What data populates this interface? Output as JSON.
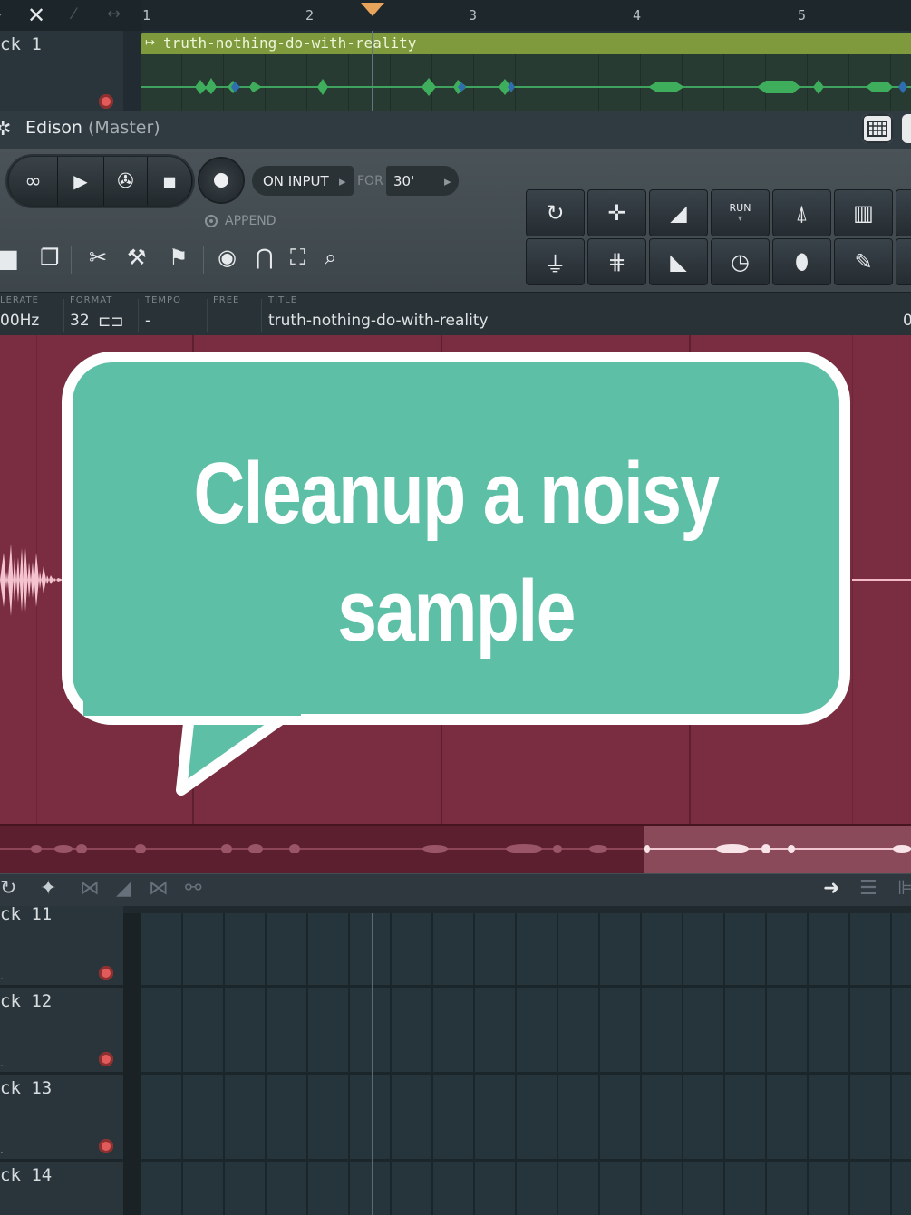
{
  "playlist_top": {
    "ruler": [
      "1",
      "2",
      "3",
      "4",
      "5"
    ],
    "track": {
      "name": "ck 1"
    },
    "clip": {
      "title": "truth-nothing-do-with-reality"
    }
  },
  "edison": {
    "title": "Edison",
    "subtitle": "(Master)",
    "transport": {
      "loop_icon": "∞",
      "play_icon": "play-icon",
      "pattern_icon": "film-reel-icon",
      "stop_icon": "stop-icon"
    },
    "trigger": {
      "value": "ON INPUT",
      "for_label": "FOR",
      "for_value": "30'"
    },
    "append_label": "APPEND",
    "fx_buttons": [
      "reverse",
      "normalize",
      "fade-in",
      "run",
      "rocket",
      "spectrum",
      "pitch",
      "noise",
      "fade-out",
      "time",
      "drop",
      "feather"
    ],
    "fx_run_label": "RUN",
    "info": {
      "samplerate_label": "LERATE",
      "samplerate_value": "00Hz",
      "format_label": "FORMAT",
      "format_value": "32",
      "tempo_label": "TEMPO",
      "tempo_value": "-",
      "free_label": "FREE",
      "title_label": "TITLE",
      "title_value": "truth-nothing-do-with-reality",
      "right_value": "0"
    }
  },
  "playlist_bottom": {
    "tracks": [
      {
        "name": "ck 11",
        "dot": "."
      },
      {
        "name": "ck 12",
        "dot": "."
      },
      {
        "name": "ck 13",
        "dot": "."
      },
      {
        "name": "ck 14",
        "dot": "."
      }
    ]
  },
  "overlay": {
    "line1": "Cleanup a noisy",
    "line2": "sample",
    "bubble_color": "#5dbfa5"
  },
  "colors": {
    "waveform_bg": "#7a2d40",
    "clip_header": "#7e9a3c",
    "accent": "#e8a45a"
  }
}
